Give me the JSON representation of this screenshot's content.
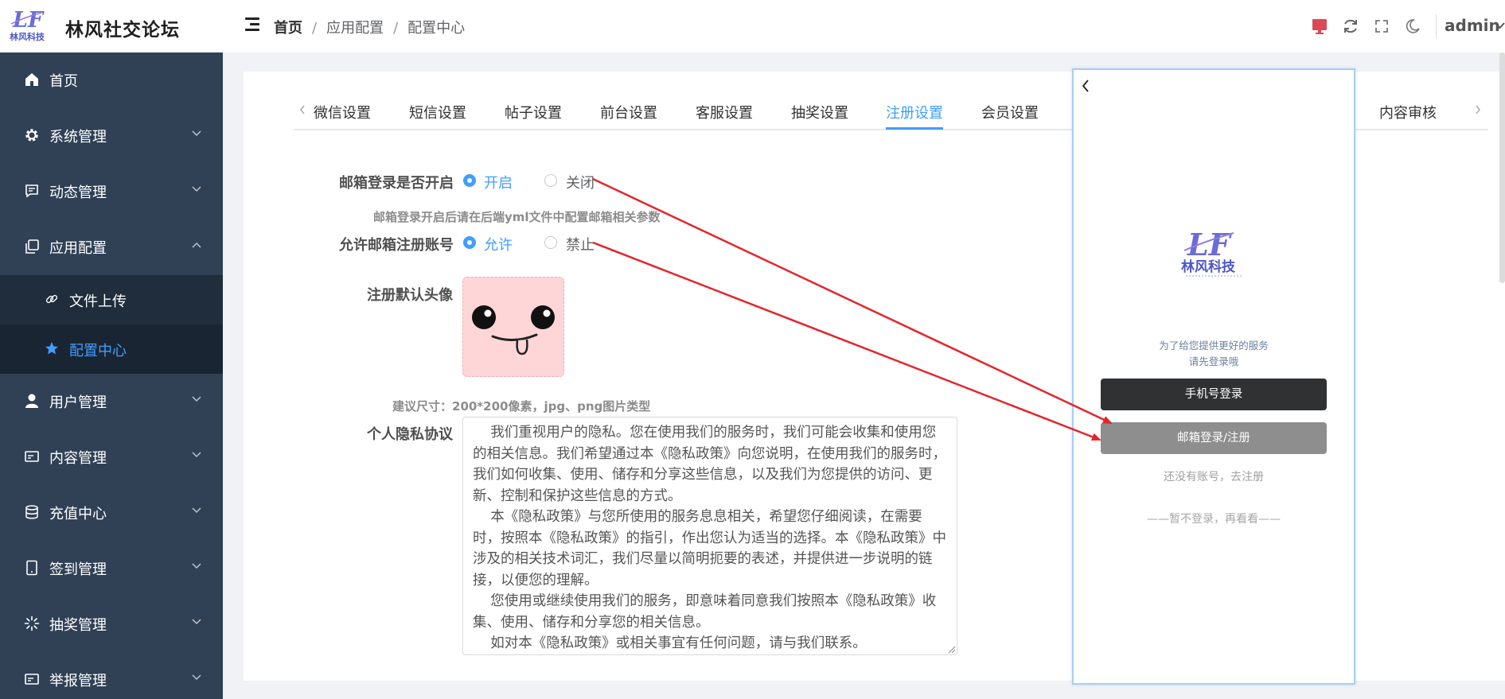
{
  "brand": {
    "name": "林风社交论坛",
    "logo_text": "林风科技"
  },
  "breadcrumb": {
    "home": "首页",
    "level2": "应用配置",
    "level3": "配置中心"
  },
  "header": {
    "user": "admin"
  },
  "sidebar": {
    "items": [
      {
        "label": "首页",
        "icon": "home-icon"
      },
      {
        "label": "系统管理",
        "icon": "gear-icon"
      },
      {
        "label": "动态管理",
        "icon": "message-icon"
      },
      {
        "label": "应用配置",
        "icon": "copy-icon"
      },
      {
        "label": "用户管理",
        "icon": "user-icon"
      },
      {
        "label": "内容管理",
        "icon": "card-icon"
      },
      {
        "label": "充值中心",
        "icon": "database-icon"
      },
      {
        "label": "签到管理",
        "icon": "tablet-icon"
      },
      {
        "label": "抽奖管理",
        "icon": "loading-icon"
      },
      {
        "label": "举报管理",
        "icon": "report-icon"
      }
    ],
    "submenu": [
      {
        "label": "文件上传",
        "icon": "link-icon"
      },
      {
        "label": "配置中心",
        "icon": "star-icon"
      }
    ]
  },
  "tabs": [
    "微信设置",
    "短信设置",
    "帖子设置",
    "前台设置",
    "客服设置",
    "抽奖设置",
    "注册设置",
    "会员设置",
    "内容审核"
  ],
  "form": {
    "email_login": {
      "label": "邮箱登录是否开启",
      "on": "开启",
      "off": "关闭"
    },
    "email_login_hint": "邮箱登录开启后请在后端yml文件中配置邮箱相关参数",
    "email_register": {
      "label": "允许邮箱注册账号",
      "on": "允许",
      "off": "禁止"
    },
    "avatar": {
      "label": "注册默认头像",
      "hint": "建议尺寸：200*200像素，jpg、png图片类型"
    },
    "privacy": {
      "label": "个人隐私协议",
      "text": "    我们重视用户的隐私。您在使用我们的服务时，我们可能会收集和使用您的相关信息。我们希望通过本《隐私政策》向您说明，在使用我们的服务时，我们如何收集、使用、储存和分享这些信息，以及我们为您提供的访问、更新、控制和保护这些信息的方式。\n    本《隐私政策》与您所使用的服务息息相关，希望您仔细阅读，在需要时，按照本《隐私政策》的指引，作出您认为适当的选择。本《隐私政策》中涉及的相关技术词汇，我们尽量以简明扼要的表述，并提供进一步说明的链接，以便您的理解。\n    您使用或继续使用我们的服务，即意味着同意我们按照本《隐私政策》收集、使用、储存和分享您的相关信息。\n    如对本《隐私政策》或相关事宜有任何问题，请与我们联系。"
    }
  },
  "phone": {
    "line1": "为了给您提供更好的服务",
    "line2": "请先登录哦",
    "phone_login": "手机号登录",
    "email_login": "邮箱登录/注册",
    "register": "还没有账号，去注册",
    "skip": "——暂不登录，再看看——"
  },
  "colors": {
    "accent": "#409eff",
    "sidebar_bg": "#304156",
    "arrow": "#e3262b"
  }
}
